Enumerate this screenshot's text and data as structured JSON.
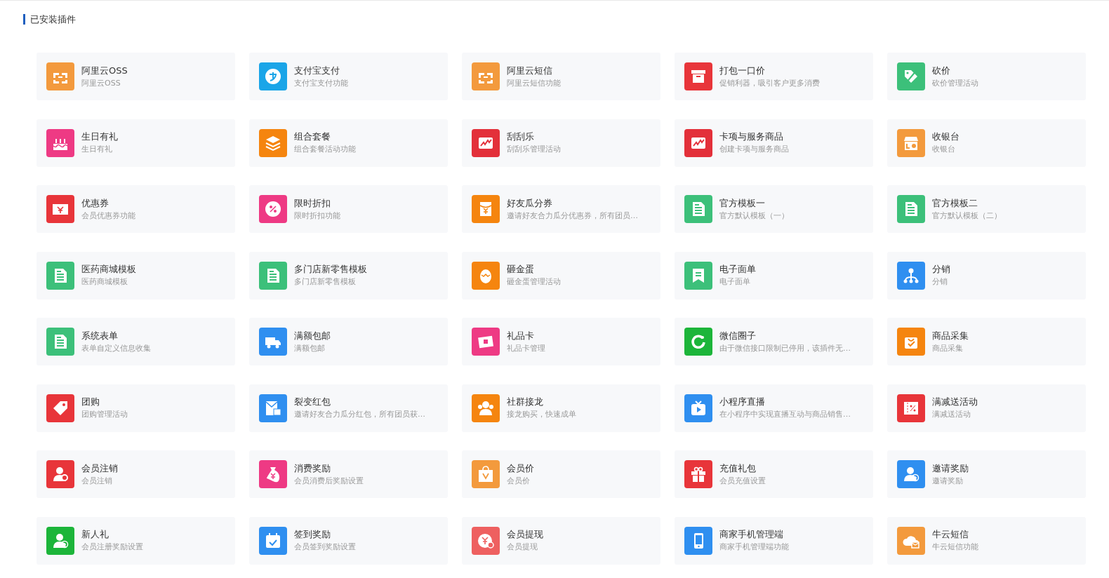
{
  "heading": "已安装插件",
  "plugins": [
    {
      "title": "阿里云OSS",
      "description": "阿里云OSS",
      "color": "#f39a3d"
    },
    {
      "title": "支付宝支付",
      "description": "支付宝支付功能",
      "color": "#1aa5e8"
    },
    {
      "title": "阿里云短信",
      "description": "阿里云短信功能",
      "color": "#f39a3d"
    },
    {
      "title": "打包一口价",
      "description": "促销利器，吸引客户更多消费",
      "color": "#e8353a"
    },
    {
      "title": "砍价",
      "description": "砍价管理活动",
      "color": "#3cc07a"
    },
    {
      "title": "生日有礼",
      "description": "生日有礼",
      "color": "#ee3a84"
    },
    {
      "title": "组合套餐",
      "description": "组合套餐活动功能",
      "color": "#f5850f"
    },
    {
      "title": "刮刮乐",
      "description": "刮刮乐管理活动",
      "color": "#e3303a"
    },
    {
      "title": "卡项与服务商品",
      "description": "创建卡项与服务商品",
      "color": "#e3303a"
    },
    {
      "title": "收银台",
      "description": "收银台",
      "color": "#f39a3d"
    },
    {
      "title": "优惠券",
      "description": "会员优惠券功能",
      "color": "#e8353a"
    },
    {
      "title": "限时折扣",
      "description": "限时折扣功能",
      "color": "#ee3a84"
    },
    {
      "title": "好友瓜分券",
      "description": "邀请好友合力瓜分优惠券，所有团员…",
      "color": "#f5850f"
    },
    {
      "title": "官方模板一",
      "description": "官方默认模板（一）",
      "color": "#3cc07a"
    },
    {
      "title": "官方模板二",
      "description": "官方默认模板（二）",
      "color": "#3cc07a"
    },
    {
      "title": "医药商城模板",
      "description": "医药商城模板",
      "color": "#3cc07a"
    },
    {
      "title": "多门店新零售模板",
      "description": "多门店新零售模板",
      "color": "#3cc07a"
    },
    {
      "title": "砸金蛋",
      "description": "砸金蛋管理活动",
      "color": "#f5850f"
    },
    {
      "title": "电子面单",
      "description": "电子面单",
      "color": "#3cc07a"
    },
    {
      "title": "分销",
      "description": "分销",
      "color": "#2f8ff0"
    },
    {
      "title": "系统表单",
      "description": "表单自定义信息收集",
      "color": "#3cc07a"
    },
    {
      "title": "满额包邮",
      "description": "满额包邮",
      "color": "#2f8ff0"
    },
    {
      "title": "礼品卡",
      "description": "礼品卡管理",
      "color": "#ee3a84"
    },
    {
      "title": "微信圈子",
      "description": "由于微信接口限制已停用，该插件无…",
      "color": "#1cb53a"
    },
    {
      "title": "商品采集",
      "description": "商品采集",
      "color": "#f5850f"
    },
    {
      "title": "团购",
      "description": "团购管理活动",
      "color": "#e8353a"
    },
    {
      "title": "裂变红包",
      "description": "邀请好友合力瓜分红包，所有团员获…",
      "color": "#2f8ff0"
    },
    {
      "title": "社群接龙",
      "description": "接龙购买，快速成单",
      "color": "#f5850f"
    },
    {
      "title": "小程序直播",
      "description": "在小程序中实现直播互动与商品销售…",
      "color": "#2f8ff0"
    },
    {
      "title": "满减送活动",
      "description": "满减送活动",
      "color": "#e8353a"
    },
    {
      "title": "会员注销",
      "description": "会员注销",
      "color": "#e8353a"
    },
    {
      "title": "消费奖励",
      "description": "会员消费后奖励设置",
      "color": "#ee3a84"
    },
    {
      "title": "会员价",
      "description": "会员价",
      "color": "#f39a3d"
    },
    {
      "title": "充值礼包",
      "description": "会员充值设置",
      "color": "#e8353a"
    },
    {
      "title": "邀请奖励",
      "description": "邀请奖励",
      "color": "#2f8ff0"
    },
    {
      "title": "新人礼",
      "description": "会员注册奖励设置",
      "color": "#1cb53a"
    },
    {
      "title": "签到奖励",
      "description": "会员签到奖励设置",
      "color": "#2f8ff0"
    },
    {
      "title": "会员提现",
      "description": "会员提现",
      "color": "#ee6060"
    },
    {
      "title": "商家手机管理端",
      "description": "商家手机管理端功能",
      "color": "#2f8ff0"
    },
    {
      "title": "牛云短信",
      "description": "牛云短信功能",
      "color": "#f39a3d"
    }
  ]
}
